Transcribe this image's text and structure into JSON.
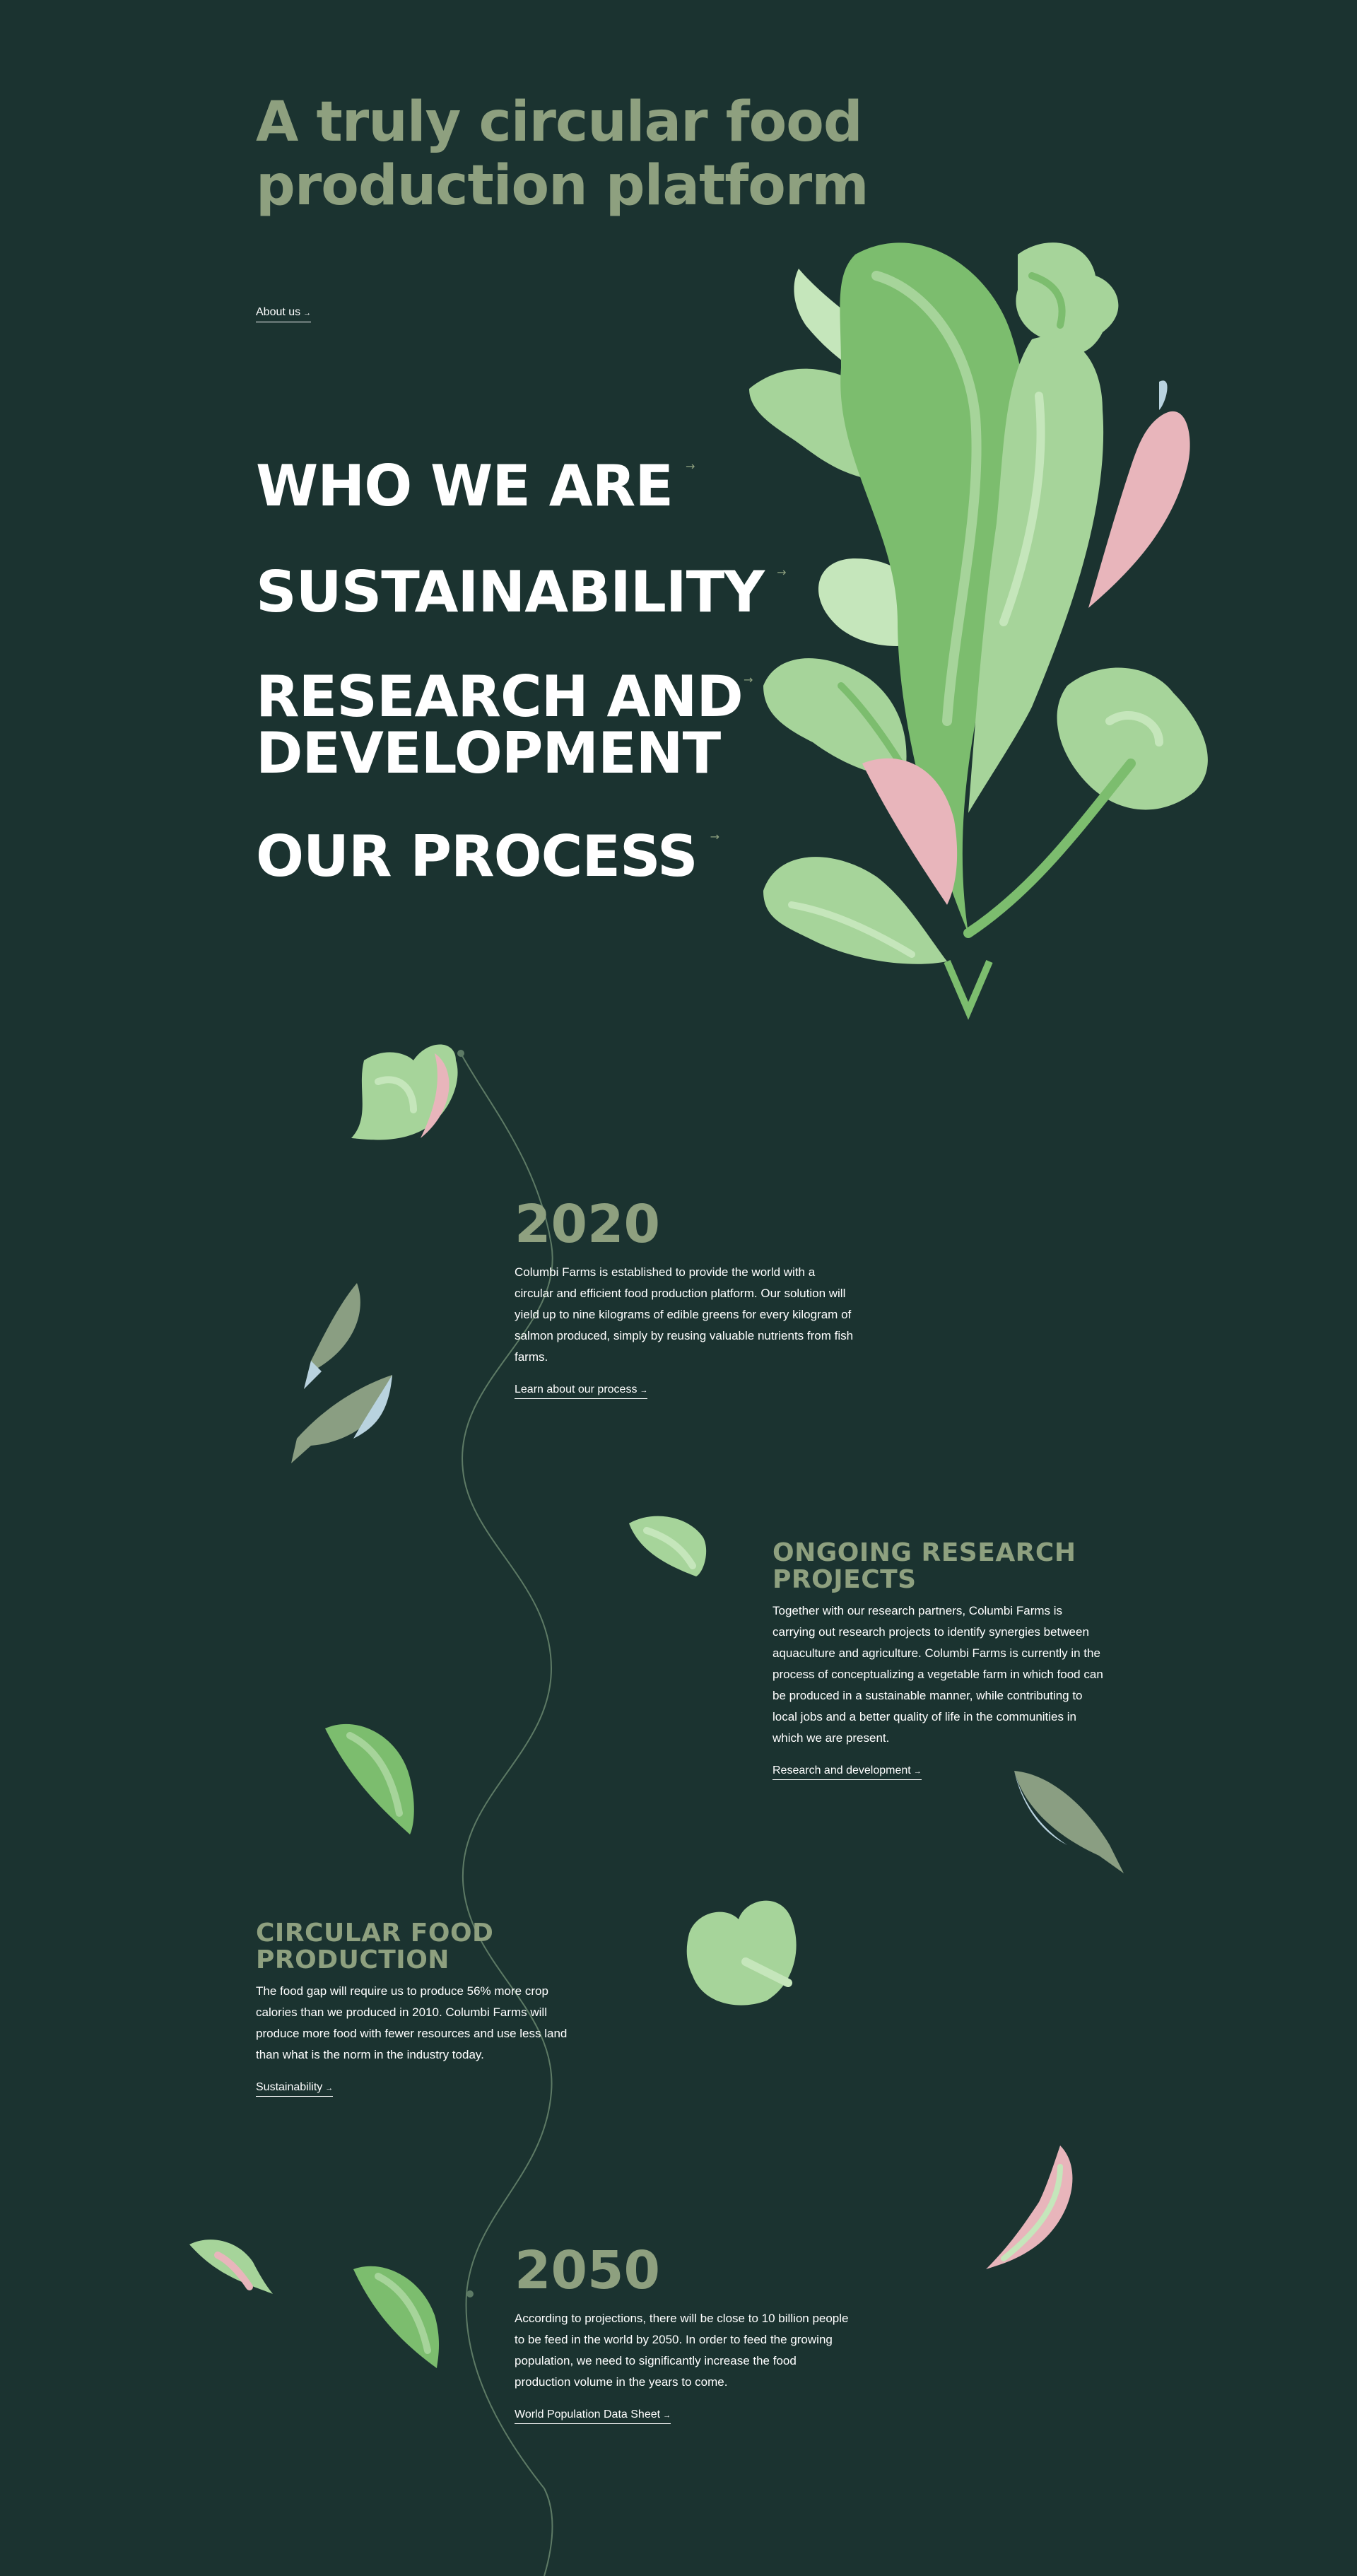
{
  "hero": {
    "title": "A truly circular food production platform",
    "link_label": "About us",
    "link_arrow": "→"
  },
  "nav": {
    "items": [
      {
        "label": "WHO WE ARE",
        "arrow": "→"
      },
      {
        "label": "SUSTAINABILITY",
        "arrow": "→"
      },
      {
        "label": "RESEARCH AND DEVELOPMENT",
        "arrow": "→"
      },
      {
        "label": "OUR PROCESS",
        "arrow": "→"
      }
    ]
  },
  "timeline": {
    "y2020": {
      "year": "2020",
      "text": "Columbi Farms is established to provide the world with a circular and efficient food production platform. Our solution will yield up to nine kilograms of edible greens for every kilogram of salmon produced, simply by reusing valuable nutrients from fish farms.",
      "link_label": "Learn about our process",
      "link_arrow": "→"
    },
    "research": {
      "title": "ONGOING RESEARCH PROJECTS",
      "text": "Together with our research partners, Columbi Farms is carrying out research projects to identify synergies between aquaculture and agriculture. Columbi Farms is currently in the process of conceptualizing a vegetable farm in which food can be produced in a sustainable manner, while contributing to local jobs and a better quality of life in the communities in which we are present.",
      "link_label": "Research and development",
      "link_arrow": "→"
    },
    "circular": {
      "title": "CIRCULAR FOOD PRODUCTION",
      "text": "The food gap will require us to produce 56% more crop calories than we produced in 2010. Columbi Farms will produce more food with fewer resources and use less land than what is the norm in the industry today.",
      "link_label": "Sustainability",
      "link_arrow": "→"
    },
    "y2050": {
      "year": "2050",
      "text": "According to projections, there will be close to 10 billion people to be feed in the world by 2050. In order to feed the growing population, we need to significantly increase the food production volume in the years to come.",
      "link_label": "World Population Data Sheet",
      "link_arrow": "→"
    }
  },
  "colors": {
    "background": "#1b3330",
    "accent_green": "#8ea07f",
    "leaf_green": "#7cbd6e",
    "leaf_light": "#a6d49a",
    "leaf_pale": "#c5e6bb",
    "leaf_pink": "#e8b5bb",
    "leaf_blue": "#b9d3df",
    "leaf_olive": "#8a9e82"
  }
}
